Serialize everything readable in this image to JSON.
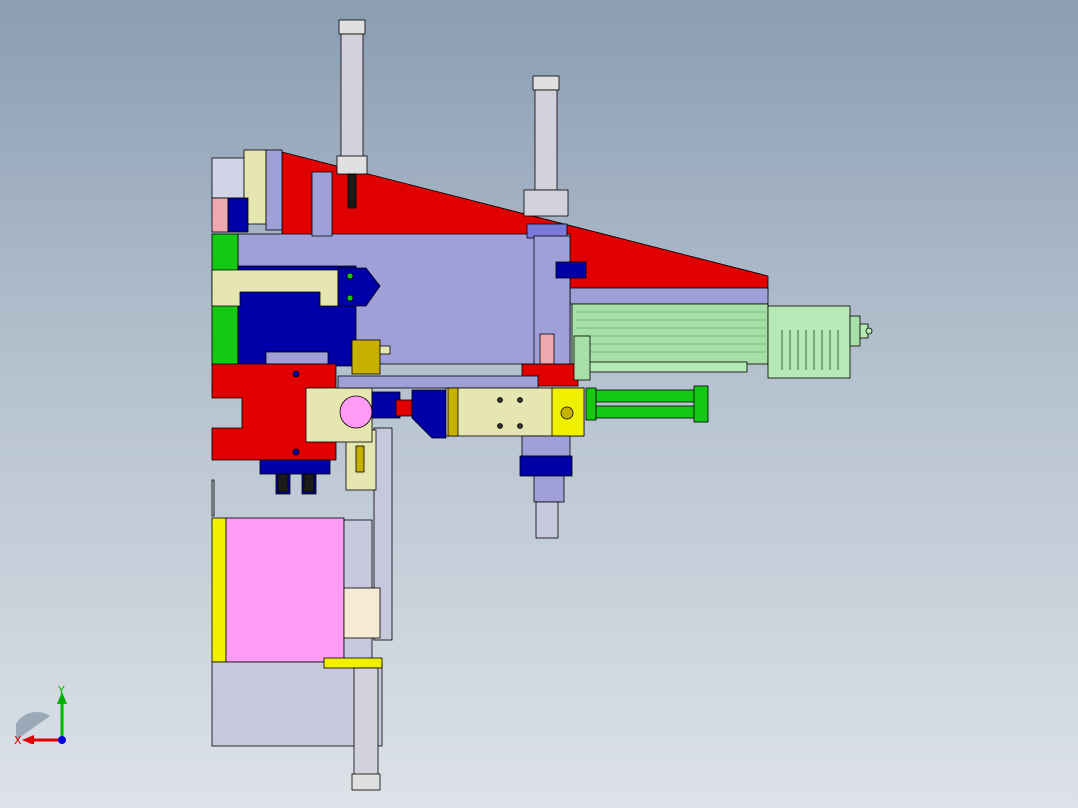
{
  "view": {
    "background_top": "#8a9db3",
    "background_bottom": "#dde2e8"
  },
  "colors": {
    "red": "#e10000",
    "periwinkle": "#a0a0d8",
    "navy": "#0000a8",
    "green": "#14c814",
    "khaki": "#e6e6b0",
    "magenta": "#ff9bf5",
    "light_green": "#a6e0a6",
    "mint": "#b5e9b5",
    "yellow": "#f0f000",
    "olive": "#c8b000",
    "pink": "#f0a8b0",
    "steel": "#c8c8dc",
    "outline": "#000000"
  },
  "components": [
    {
      "key": "frame",
      "name": "main-frame"
    },
    {
      "key": "wedge",
      "name": "red-wedge-plate"
    },
    {
      "key": "cylinder_top",
      "name": "top-air-cylinder"
    },
    {
      "key": "cylinder_mid",
      "name": "vertical-air-cylinder"
    },
    {
      "key": "motor",
      "name": "servo-motor"
    },
    {
      "key": "gripper",
      "name": "gripper-assembly"
    },
    {
      "key": "green_cylinders",
      "name": "twin-green-cylinders"
    },
    {
      "key": "magenta_block",
      "name": "magenta-feed-block"
    },
    {
      "key": "cylinder_bottom",
      "name": "bottom-air-cylinder"
    }
  ],
  "triad": {
    "x_label": "X",
    "y_label": "Y",
    "x_color": "#e00000",
    "y_color": "#00b000",
    "z_color": "#0000e0"
  }
}
